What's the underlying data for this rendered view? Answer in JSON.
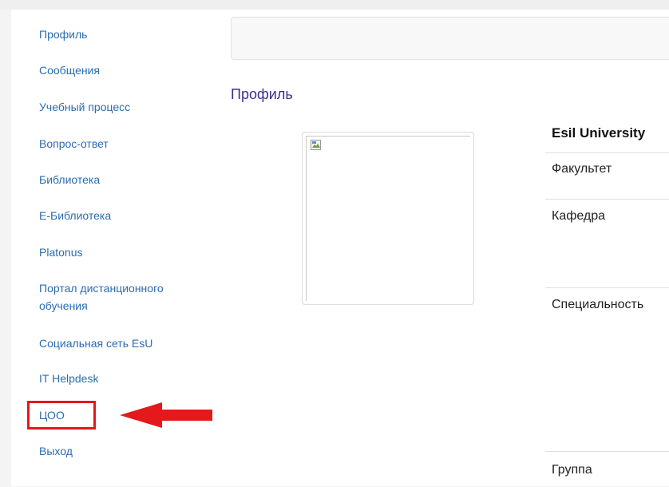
{
  "sidebar": {
    "items": [
      {
        "label": "Профиль"
      },
      {
        "label": "Сообщения"
      },
      {
        "label": "Учебный процесс"
      },
      {
        "label": "Вопрос-ответ"
      },
      {
        "label": "Библиотека"
      },
      {
        "label": "E-Библиотека"
      },
      {
        "label": "Platonus"
      },
      {
        "label": "Портал дистанционного",
        "label2": "обучения"
      },
      {
        "label": "Социальная сеть EsU"
      },
      {
        "label": "IT Helpdesk"
      },
      {
        "label": "ЦОО"
      },
      {
        "label": "Выход"
      }
    ]
  },
  "main": {
    "page_title": "Профиль",
    "photo": {
      "icon": "broken-image-icon"
    },
    "info_table": {
      "header": "Esil University",
      "rows": [
        {
          "label": "Факультет"
        },
        {
          "label": "Кафедра"
        },
        {
          "label": "Специальность"
        },
        {
          "label": "Группа"
        }
      ]
    }
  },
  "annotation": {
    "highlight_color": "#e3191c",
    "arrow_color": "#e3191c"
  }
}
